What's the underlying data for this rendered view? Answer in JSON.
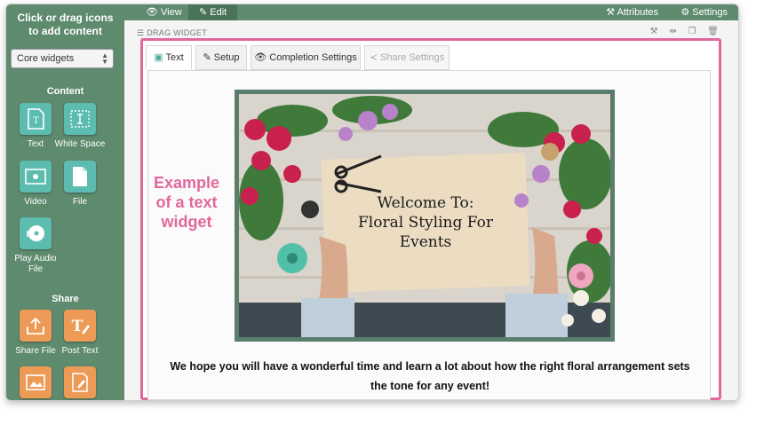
{
  "sidebar": {
    "instructions": "Click or drag icons to add content",
    "selector_value": "Core widgets",
    "sections": [
      {
        "heading": "Content",
        "items": [
          {
            "label": "Text",
            "icon": "text-widget-icon"
          },
          {
            "label": "White Space",
            "icon": "white-space-icon"
          },
          {
            "label": "Video",
            "icon": "video-icon"
          },
          {
            "label": "File",
            "icon": "file-icon"
          },
          {
            "label": "Play Audio File",
            "icon": "audio-file-icon"
          }
        ]
      },
      {
        "heading": "Share",
        "items": [
          {
            "label": "Share File",
            "icon": "share-file-icon"
          },
          {
            "label": "Post Text",
            "icon": "post-text-icon"
          }
        ]
      }
    ]
  },
  "topbar": {
    "view": "View",
    "edit": "Edit",
    "attributes": "Attributes",
    "settings": "Settings"
  },
  "widget": {
    "drag_label": "DRAG WIDGET",
    "tabs": [
      "Text",
      "Setup",
      "Completion Settings",
      "Share Settings"
    ],
    "hero_title": [
      "Welcome To:",
      "Floral Styling For",
      "Events"
    ],
    "caption": "We hope you will have a wonderful time and learn a lot about how the right floral arrangement sets the tone for any event!"
  },
  "annotation": "Example of a text widget",
  "colors": {
    "sidebar": "#5e8a6e",
    "highlight": "#e2679b",
    "teal_icon": "#5dbcb0",
    "orange_icon": "#ec9a55"
  }
}
